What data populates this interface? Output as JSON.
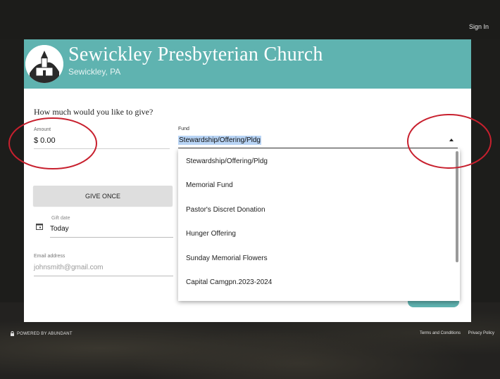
{
  "top_bar": {
    "sign_in": "Sign In"
  },
  "header": {
    "church_name": "Sewickley Presbyterian Church",
    "location": "Sewickley, PA"
  },
  "form": {
    "question": "How much would you like to give?",
    "amount": {
      "label": "Amount",
      "value": "$ 0.00"
    },
    "fund": {
      "label": "Fund",
      "value": "Stewardship/Offering/Pldg"
    },
    "give_once_label": "GIVE ONCE",
    "gift_date": {
      "label": "Gift date",
      "value": "Today"
    },
    "email": {
      "label": "Email address",
      "placeholder": "johnsmith@gmail.com"
    }
  },
  "dropdown": {
    "options": [
      "Stewardship/Offering/Pldg",
      "Memorial Fund",
      "Pastor's Discret Donation",
      "Hunger Offering",
      "Sunday Memorial Flowers",
      "Capital Camgpn.2023-2024"
    ]
  },
  "footer": {
    "powered_by": "POWERED BY ABUNDANT",
    "terms": "Terms and Conditions",
    "privacy": "Privacy Policy"
  },
  "colors": {
    "brand_teal": "#5fb3b0",
    "annotation_red": "#c8202e",
    "selection_blue": "#b8d4f5"
  }
}
